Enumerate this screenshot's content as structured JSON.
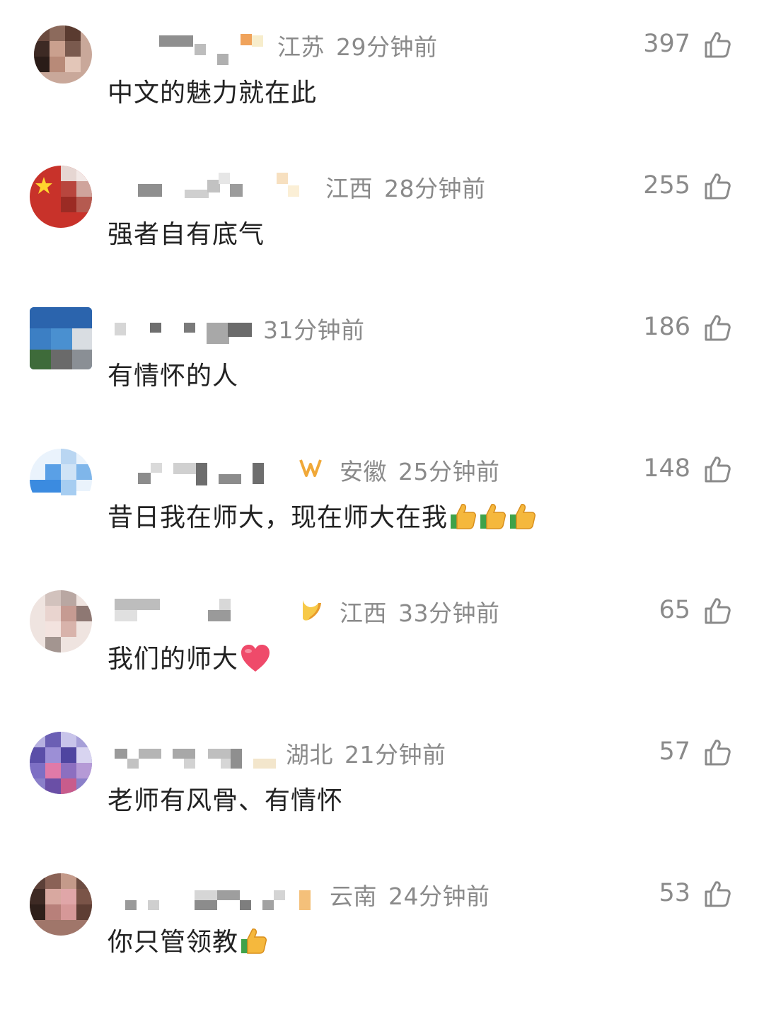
{
  "comments": [
    {
      "location": "江苏",
      "time": "29分钟前",
      "text": "中文的魅力就在此",
      "likes": "397"
    },
    {
      "location": "江西",
      "time": "28分钟前",
      "text": "强者自有底气",
      "likes": "255"
    },
    {
      "location": "",
      "time": "31分钟前",
      "text": "有情怀的人",
      "likes": "186"
    },
    {
      "location": "安徽",
      "time": "25分钟前",
      "text": "昔日我在师大，现在师大在我",
      "likes": "148"
    },
    {
      "location": "江西",
      "time": "33分钟前",
      "text": "我们的师大",
      "likes": "65"
    },
    {
      "location": "湖北",
      "time": "21分钟前",
      "text": "老师有风骨、有情怀",
      "likes": "57"
    },
    {
      "location": "云南",
      "time": "24分钟前",
      "text": "你只管领教",
      "likes": "53"
    }
  ],
  "icons": {
    "like": "thumbs-up-outline-icon",
    "thumbs_emoji": "thumbs-up-emoji-icon",
    "heart_emoji": "heart-emoji-icon"
  },
  "colors": {
    "meta_text": "#8a8a8a",
    "body_text": "#222222",
    "emoji_yellow": "#f5b83d",
    "heart": "#ef4a6a"
  }
}
